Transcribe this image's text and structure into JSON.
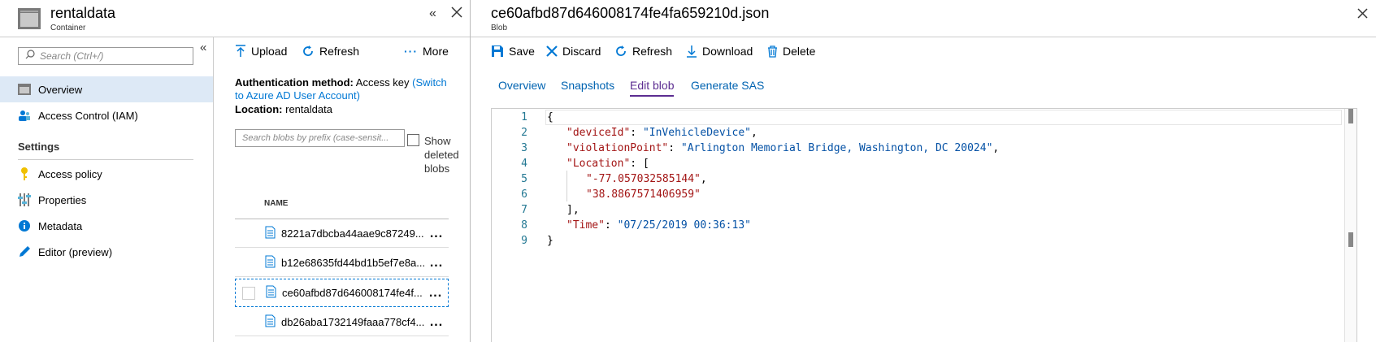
{
  "left_header": {
    "title": "rentaldata",
    "subtitle": "Container"
  },
  "sidebar": {
    "search_placeholder": "Search (Ctrl+/)",
    "items": [
      {
        "label": "Overview",
        "icon": "overview-icon"
      },
      {
        "label": "Access Control (IAM)",
        "icon": "iam-icon"
      }
    ],
    "section_label": "Settings",
    "settings_items": [
      {
        "label": "Access policy",
        "icon": "key-icon"
      },
      {
        "label": "Properties",
        "icon": "properties-icon"
      },
      {
        "label": "Metadata",
        "icon": "info-icon"
      },
      {
        "label": "Editor (preview)",
        "icon": "pencil-icon"
      }
    ]
  },
  "blob_panel": {
    "toolbar": {
      "upload": "Upload",
      "refresh": "Refresh",
      "more": "More"
    },
    "auth_label": "Authentication method:",
    "auth_value": "Access key",
    "auth_link_1": "(Switch",
    "auth_link_2": "to Azure AD User Account)",
    "location_label": "Location:",
    "location_value": "rentaldata",
    "search_placeholder": "Search blobs by prefix (case-sensit...",
    "show_deleted_1": "Show",
    "show_deleted_2": "deleted",
    "show_deleted_3": "blobs",
    "column_name": "NAME",
    "blobs": [
      "8221a7dbcba44aae9c87249...",
      "b12e68635fd44bd1b5ef7e8a...",
      "ce60afbd87d646008174fe4f...",
      "db26aba1732149faaa778cf4..."
    ],
    "more_dots": "..."
  },
  "blob_editor": {
    "title": "ce60afbd87d646008174fe4fa659210d.json",
    "subtitle": "Blob",
    "toolbar": {
      "save": "Save",
      "discard": "Discard",
      "refresh": "Refresh",
      "download": "Download",
      "delete": "Delete"
    },
    "tabs": [
      "Overview",
      "Snapshots",
      "Edit blob",
      "Generate SAS"
    ],
    "active_tab": "Edit blob",
    "line_numbers": [
      "1",
      "2",
      "3",
      "4",
      "5",
      "6",
      "7",
      "8",
      "9"
    ],
    "code": {
      "l1": "{",
      "l2_key": "\"deviceId\"",
      "l2_val": "\"InVehicleDevice\"",
      "l3_key": "\"violationPoint\"",
      "l3_val": "\"Arlington Memorial Bridge, Washington, DC 20024\"",
      "l4_key": "\"Location\"",
      "l4_open": "[",
      "l5_val": "\"-77.057032585144\"",
      "l6_val": "\"38.8867571406959\"",
      "l7": "],",
      "l8_key": "\"Time\"",
      "l8_val": "\"07/25/2019 00:36:13\"",
      "l9": "}"
    }
  }
}
